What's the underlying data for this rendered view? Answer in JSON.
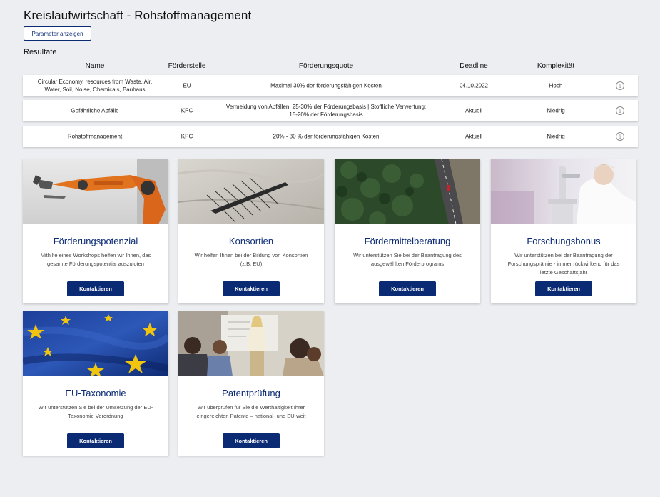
{
  "page": {
    "title": "Kreislaufwirtschaft - Rohstoffmanagement",
    "param_button": "Parameter anzeigen",
    "results_label": "Resultate"
  },
  "table": {
    "headers": {
      "name": "Name",
      "stelle": "Förderstelle",
      "quote": "Förderungsquote",
      "deadline": "Deadline",
      "komplex": "Komplexität"
    },
    "rows": [
      {
        "name": "Circular Economy, resources from Waste, Air, Water, Soil, Noise, Chemicals, Bauhaus",
        "stelle": "EU",
        "quote": "Maximal 30% der förderungsfähigen Kosten",
        "deadline": "04.10.2022",
        "komplex": "Hoch"
      },
      {
        "name": "Gefährliche Abfälle",
        "stelle": "KPC",
        "quote": "Vermeidung von Abfällen: 25-30% der Förderungsbasis | Stoffliche Verwertung: 15-20% der Förderungsbasis",
        "deadline": "Aktuell",
        "komplex": "Niedrig"
      },
      {
        "name": "Rohstoffmanagement",
        "stelle": "KPC",
        "quote": "20% - 30 % der förderungsfähigen Kosten",
        "deadline": "Aktuell",
        "komplex": "Niedrig"
      }
    ],
    "info_glyph": "i"
  },
  "cards": [
    {
      "title": "Förderungspotenzial",
      "desc": "Mithilfe eines Workshops helfen wir Ihnen, das gesamte Förderungspotential auszuloten",
      "button": "Kontaktieren",
      "image": "robot-arm"
    },
    {
      "title": "Konsortien",
      "desc": "Wir helfen Ihnen bei der Bildung von Konsortien (z.B. EU)",
      "button": "Kontaktieren",
      "image": "rowing-boat"
    },
    {
      "title": "Fördermittelberatung",
      "desc": "Wir unterstützen Sie bei der Beantragung des ausgewählten Förderprograms",
      "button": "Kontaktieren",
      "image": "forest-road"
    },
    {
      "title": "Forschungsbonus",
      "desc": "Wir unterstützen bei der Beantragung der Forschungsprämie - immer rückwirkend für das letzte Geschäftsjahr",
      "button": "Kontaktieren",
      "image": "microscope-lab"
    },
    {
      "title": "EU-Taxonomie",
      "desc": "Wir unterstützen Sie bei der Umsetzung der EU-Taxonomie Verordnung",
      "button": "Kontaktieren",
      "image": "eu-flag"
    },
    {
      "title": "Patentprüfung",
      "desc": "Wir überprüfen für Sie die Werthaltigkeit Ihrer eingereichten Patente – national- und EU-weit",
      "button": "Kontaktieren",
      "image": "meeting-presentation"
    }
  ],
  "colors": {
    "brand": "#0a2a74",
    "background": "#eceef1"
  }
}
